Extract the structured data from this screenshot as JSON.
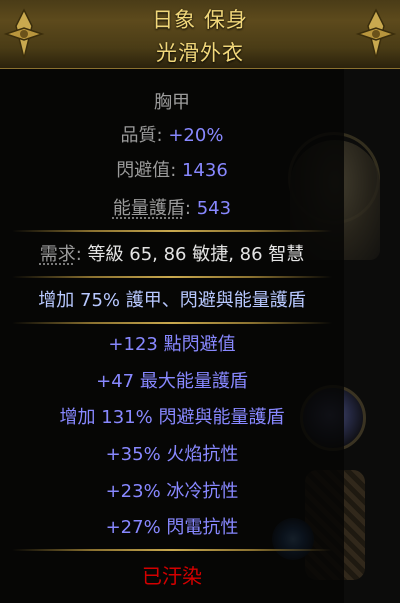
{
  "item": {
    "name": "日象 保身",
    "base_type": "光滑外衣",
    "item_class": "胸甲",
    "properties": [
      {
        "label": "品質",
        "value": "+20%"
      },
      {
        "label": "閃避值",
        "value": "1436"
      },
      {
        "label": "能量護盾",
        "value": "543"
      }
    ],
    "requirements": {
      "label": "需求",
      "text": "等級 65, 86 敏捷, 86 智慧"
    },
    "implicit": "增加 75% 護甲、閃避與能量護盾",
    "explicit_mods": [
      "+123 點閃避值",
      "+47 最大能量護盾",
      "增加 131% 閃避與能量護盾",
      "+35% 火焰抗性",
      "+23% 冰冷抗性",
      "+27% 閃電抗性"
    ],
    "corrupted": "已汙染"
  },
  "colors": {
    "header_text": "#f1d77a",
    "label_grey": "#9b9b9b",
    "value_blue": "#8888ff",
    "corrupted_red": "#d20000",
    "separator_gold": "#8a7130"
  }
}
